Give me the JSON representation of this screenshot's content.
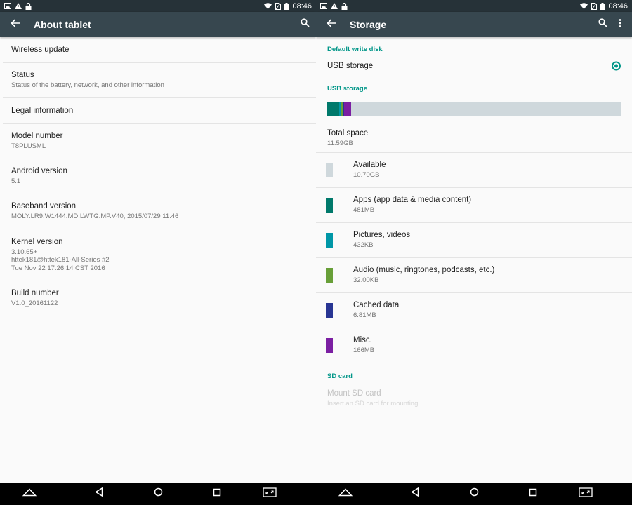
{
  "status_bar": {
    "time": "08:46"
  },
  "left": {
    "title": "About tablet",
    "items": [
      {
        "title": "Wireless update",
        "summary": ""
      },
      {
        "title": "Status",
        "summary": "Status of the battery, network, and other information"
      },
      {
        "title": "Legal information",
        "summary": ""
      },
      {
        "title": "Model number",
        "summary": "T8PLUSML"
      },
      {
        "title": "Android version",
        "summary": "5.1"
      },
      {
        "title": "Baseband version",
        "summary": "MOLY.LR9.W1444.MD.LWTG.MP.V40, 2015/07/29 11:46"
      },
      {
        "title": "Kernel version",
        "summary_lines": [
          "3.10.65+",
          "httek181@httek181-All-Series #2",
          "Tue Nov 22 17:26:14 CST 2016"
        ]
      },
      {
        "title": "Build number",
        "summary": "V1.0_20161122"
      }
    ]
  },
  "right": {
    "title": "Storage",
    "default_write_disk": {
      "header": "Default write disk",
      "option": "USB storage",
      "selected": true
    },
    "usb_storage": {
      "header": "USB storage",
      "total": {
        "title": "Total space",
        "value": "11.59GB"
      },
      "categories": [
        {
          "name": "Available",
          "size": "10.70GB",
          "color": "#cfd8dc"
        },
        {
          "name": "Apps (app data & media content)",
          "size": "481MB",
          "color": "#00796b"
        },
        {
          "name": "Pictures, videos",
          "size": "432KB",
          "color": "#0097a7"
        },
        {
          "name": "Audio (music, ringtones, podcasts, etc.)",
          "size": "32.00KB",
          "color": "#689f38"
        },
        {
          "name": "Cached data",
          "size": "6.81MB",
          "color": "#283593"
        },
        {
          "name": "Misc.",
          "size": "166MB",
          "color": "#7b1fa2"
        }
      ],
      "usage_bar": [
        {
          "color": "#00796b",
          "fraction": 0.041
        },
        {
          "color": "#0097a7",
          "fraction": 0.007
        },
        {
          "color": "#689f38",
          "fraction": 0.005
        },
        {
          "color": "#283593",
          "fraction": 0.005
        },
        {
          "color": "#7b1fa2",
          "fraction": 0.024
        }
      ]
    },
    "sd_card": {
      "header": "SD card",
      "title": "Mount SD card",
      "summary": "Insert an SD card for mounting"
    }
  },
  "colors": {
    "accent": "#009688",
    "toolbar": "#37474f",
    "statusbar": "#263238",
    "navbar": "#000000"
  },
  "icons": {
    "back": "arrow-left-icon",
    "search": "search-icon",
    "overflow": "more-vert-icon"
  }
}
